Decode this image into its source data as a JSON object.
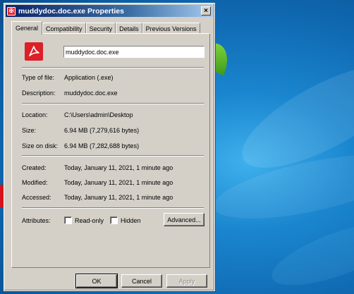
{
  "window": {
    "title": "muddydoc.doc.exe Properties",
    "close_glyph": "×"
  },
  "tabs": [
    {
      "label": "General",
      "active": true
    },
    {
      "label": "Compatibility",
      "active": false
    },
    {
      "label": "Security",
      "active": false
    },
    {
      "label": "Details",
      "active": false
    },
    {
      "label": "Previous Versions",
      "active": false
    }
  ],
  "general": {
    "file_name": "muddydoc.doc.exe",
    "icon": "pdf-file-icon",
    "accent_color": "#dd1f27",
    "type_label": "Type of file:",
    "type_value": "Application (.exe)",
    "description_label": "Description:",
    "description_value": "muddydoc.doc.exe",
    "location_label": "Location:",
    "location_value": "C:\\Users\\admin\\Desktop",
    "size_label": "Size:",
    "size_value": "6.94 MB (7,279,616 bytes)",
    "size_on_disk_label": "Size on disk:",
    "size_on_disk_value": "6.94 MB (7,282,688 bytes)",
    "created_label": "Created:",
    "created_value": "Today, January 11, 2021, 1 minute ago",
    "modified_label": "Modified:",
    "modified_value": "Today, January 11, 2021, 1 minute ago",
    "accessed_label": "Accessed:",
    "accessed_value": "Today, January 11, 2021, 1 minute ago",
    "attributes_label": "Attributes:",
    "readonly_label": "Read-only",
    "readonly_checked": false,
    "hidden_label": "Hidden",
    "hidden_checked": false,
    "advanced_label": "Advanced..."
  },
  "buttons": {
    "ok": "OK",
    "cancel": "Cancel",
    "apply": "Apply"
  }
}
